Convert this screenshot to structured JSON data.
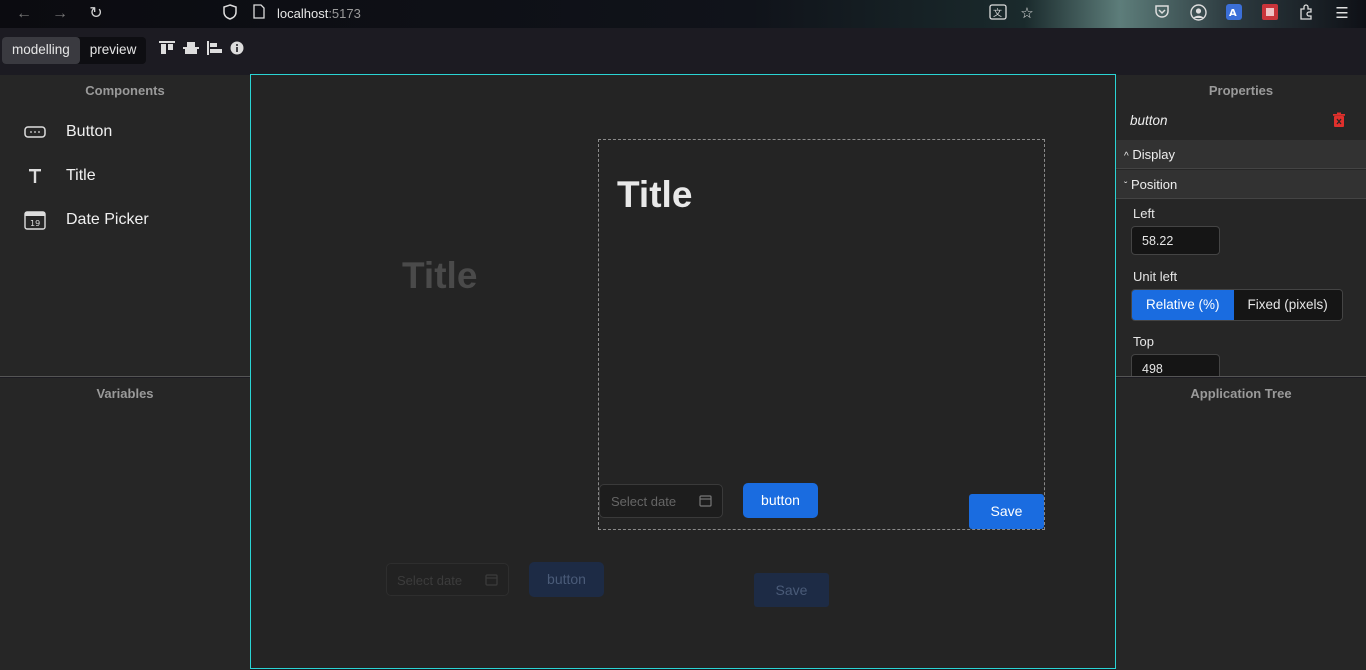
{
  "browser": {
    "url_host": "localhost",
    "url_port": ":5173"
  },
  "toolbar": {
    "modes": [
      "modelling",
      "preview"
    ]
  },
  "components_panel": {
    "title": "Components",
    "items": [
      {
        "label": "Button",
        "icon": "button-icon"
      },
      {
        "label": "Title",
        "icon": "text-icon"
      },
      {
        "label": "Date Picker",
        "icon": "calendar-icon"
      }
    ]
  },
  "variables_panel": {
    "title": "Variables"
  },
  "canvas": {
    "ghost": {
      "title": "Title",
      "date_placeholder": "Select date",
      "button": "button",
      "save": "Save"
    },
    "container": {
      "title": "Title",
      "date_placeholder": "Select date",
      "button": "button",
      "save": "Save"
    }
  },
  "properties_panel": {
    "title": "Properties",
    "selected": "button",
    "sections": [
      "Display",
      "Position"
    ],
    "left_label": "Left",
    "left_value": "58.22",
    "unit_left_label": "Unit left",
    "unit_options": [
      "Relative (%)",
      "Fixed (pixels)"
    ],
    "top_label": "Top",
    "top_value": "498"
  },
  "tree_panel": {
    "title": "Application Tree"
  },
  "colors": {
    "accent": "#1a6ce0",
    "canvas_border": "#2ad4d4",
    "danger": "#e0302c"
  }
}
